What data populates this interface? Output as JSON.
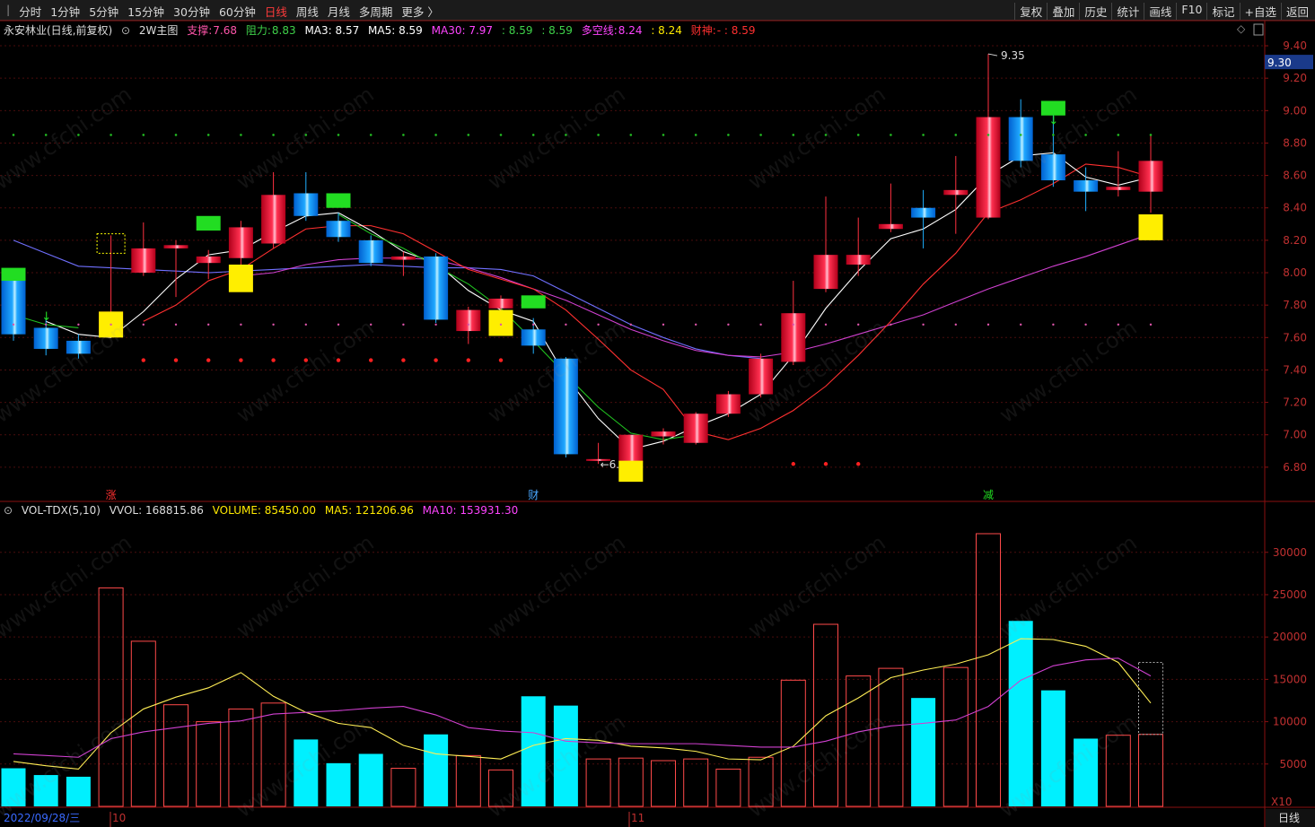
{
  "toolbar": {
    "left": [
      "分时",
      "1分钟",
      "5分钟",
      "15分钟",
      "30分钟",
      "60分钟",
      "日线",
      "周线",
      "月线",
      "多周期",
      "更多 〉"
    ],
    "active_index": 6,
    "right": [
      "复权",
      "叠加",
      "历史",
      "统计",
      "画线",
      "F10",
      "标记",
      "+自选",
      "返回"
    ]
  },
  "legend": {
    "stock": "永安林业(日线,前复权)",
    "indicator": "2W主图",
    "support_label": "支撑:",
    "support_value": "7.68",
    "resist_label": "阻力:",
    "resist_value": "8.83",
    "ma3": "MA3: 8.57",
    "ma5": "MA5: 8.59",
    "ma30": "MA30: 7.97",
    "v1": ": 8.59",
    "v2": ": 8.59",
    "dk_label": "多空线:",
    "dk_value": "8.24",
    "v3": ": 8.24",
    "cs_label": "财神:",
    "cs_value": "- : 8.59"
  },
  "vol_legend": {
    "name": "VOL-TDX(5,10)",
    "vvol": "VVOL: 168815.86",
    "volume": "VOLUME: 85450.00",
    "ma5": "MA5: 121206.96",
    "ma10": "MA10: 153931.30"
  },
  "price_badge": "9.30",
  "high_label": "9.35",
  "low_label": "6.",
  "markers": [
    "涨",
    "财",
    "减"
  ],
  "date_label": "2022/09/28/三",
  "month_labels": [
    "10",
    "11"
  ],
  "x10_label": "X10",
  "period_label": "日线",
  "watermark": "www.cfchi.com",
  "colors": {
    "up": "#ff2b3c",
    "down": "#1aa6ff",
    "ma_white": "#ffffff",
    "ma_red": "#ff3030",
    "ma_mag": "#d040d0",
    "ma_blue": "#6a6aff",
    "ma_green": "#20c020"
  },
  "chart_data": {
    "type": "candlestick",
    "price_axis": {
      "ticks": [
        6.8,
        7.0,
        7.2,
        7.4,
        7.6,
        7.8,
        8.0,
        8.2,
        8.4,
        8.6,
        8.8,
        9.0,
        9.2,
        9.4
      ],
      "ylim": [
        6.6,
        9.45
      ]
    },
    "volume_axis": {
      "ticks": [
        5000,
        10000,
        15000,
        20000,
        25000,
        30000
      ],
      "ylim": [
        0,
        34000
      ]
    },
    "candles": [
      {
        "o": 7.96,
        "c": 7.62,
        "h": 7.98,
        "l": 7.58
      },
      {
        "o": 7.66,
        "c": 7.53,
        "h": 7.72,
        "l": 7.49
      },
      {
        "o": 7.58,
        "c": 7.5,
        "h": 7.62,
        "l": 7.47
      },
      {
        "o": 7.62,
        "c": 7.76,
        "h": 8.23,
        "l": 7.6
      },
      {
        "o": 8.0,
        "c": 8.15,
        "h": 8.31,
        "l": 7.98
      },
      {
        "o": 8.15,
        "c": 8.17,
        "h": 8.2,
        "l": 7.85
      },
      {
        "o": 8.06,
        "c": 8.1,
        "h": 8.14,
        "l": 7.96
      },
      {
        "o": 8.09,
        "c": 8.28,
        "h": 8.32,
        "l": 8.05
      },
      {
        "o": 8.18,
        "c": 8.48,
        "h": 8.62,
        "l": 8.15
      },
      {
        "o": 8.49,
        "c": 8.35,
        "h": 8.62,
        "l": 8.32
      },
      {
        "o": 8.32,
        "c": 8.22,
        "h": 8.37,
        "l": 8.19
      },
      {
        "o": 8.2,
        "c": 8.06,
        "h": 8.23,
        "l": 8.04
      },
      {
        "o": 8.08,
        "c": 8.1,
        "h": 8.13,
        "l": 7.98
      },
      {
        "o": 8.1,
        "c": 7.71,
        "h": 8.12,
        "l": 7.69
      },
      {
        "o": 7.64,
        "c": 7.77,
        "h": 7.79,
        "l": 7.56
      },
      {
        "o": 7.78,
        "c": 7.84,
        "h": 7.86,
        "l": 7.76
      },
      {
        "o": 7.65,
        "c": 7.55,
        "h": 7.72,
        "l": 7.5
      },
      {
        "o": 7.47,
        "c": 6.88,
        "h": 7.48,
        "l": 6.86
      },
      {
        "o": 6.84,
        "c": 6.85,
        "h": 6.95,
        "l": 6.82
      },
      {
        "o": 6.83,
        "c": 7.0,
        "h": 7.0,
        "l": 6.81
      },
      {
        "o": 6.99,
        "c": 7.02,
        "h": 7.04,
        "l": 6.94
      },
      {
        "o": 6.95,
        "c": 7.13,
        "h": 7.14,
        "l": 6.94
      },
      {
        "o": 7.13,
        "c": 7.25,
        "h": 7.27,
        "l": 7.11
      },
      {
        "o": 7.25,
        "c": 7.47,
        "h": 7.5,
        "l": 7.23
      },
      {
        "o": 7.45,
        "c": 7.75,
        "h": 7.95,
        "l": 7.43
      },
      {
        "o": 7.9,
        "c": 8.11,
        "h": 8.47,
        "l": 7.88
      },
      {
        "o": 8.05,
        "c": 8.11,
        "h": 8.34,
        "l": 7.98
      },
      {
        "o": 8.27,
        "c": 8.3,
        "h": 8.55,
        "l": 8.25
      },
      {
        "o": 8.4,
        "c": 8.34,
        "h": 8.51,
        "l": 8.15
      },
      {
        "o": 8.48,
        "c": 8.51,
        "h": 8.72,
        "l": 8.24
      },
      {
        "o": 8.34,
        "c": 8.96,
        "h": 9.35,
        "l": 8.33
      },
      {
        "o": 8.96,
        "c": 8.69,
        "h": 9.07,
        "l": 8.65
      },
      {
        "o": 8.73,
        "c": 8.57,
        "h": 9.0,
        "l": 8.53
      },
      {
        "o": 8.57,
        "c": 8.5,
        "h": 8.65,
        "l": 8.38
      },
      {
        "o": 8.51,
        "c": 8.53,
        "h": 8.75,
        "l": 8.47
      },
      {
        "o": 8.5,
        "c": 8.69,
        "h": 8.85,
        "l": 8.37
      }
    ],
    "volumes": [
      4500,
      3700,
      3500,
      25800,
      19500,
      12000,
      10000,
      11500,
      12200,
      7900,
      5100,
      6200,
      4500,
      8500,
      6000,
      4300,
      13000,
      11900,
      5600,
      5700,
      5400,
      5600,
      4400,
      5800,
      14900,
      21500,
      15400,
      16300,
      12800,
      16400,
      32200,
      21900,
      13700,
      8000,
      8400,
      8500
    ],
    "ma_white": [
      null,
      7.7,
      7.62,
      7.6,
      7.76,
      7.96,
      8.11,
      8.14,
      8.25,
      8.35,
      8.37,
      8.26,
      8.13,
      8.06,
      7.89,
      7.77,
      7.7,
      7.36,
      7.1,
      6.91,
      6.96,
      7.05,
      7.13,
      7.25,
      7.49,
      7.78,
      8.01,
      8.21,
      8.27,
      8.39,
      8.6,
      8.72,
      8.74,
      8.59,
      8.54,
      8.59
    ],
    "ma_red": [
      null,
      null,
      null,
      null,
      7.7,
      7.8,
      7.95,
      8.02,
      8.15,
      8.27,
      8.29,
      8.29,
      8.24,
      8.13,
      8.02,
      7.96,
      7.9,
      7.77,
      7.59,
      7.4,
      7.28,
      7.02,
      6.97,
      7.04,
      7.15,
      7.3,
      7.49,
      7.7,
      7.93,
      8.12,
      8.37,
      8.45,
      8.55,
      8.67,
      8.65,
      8.59
    ],
    "ma_magenta": [
      null,
      null,
      null,
      null,
      null,
      null,
      null,
      7.98,
      8.0,
      8.05,
      8.08,
      8.09,
      8.09,
      8.08,
      8.03,
      7.97,
      7.9,
      7.83,
      7.74,
      7.65,
      7.58,
      7.52,
      7.49,
      7.48,
      7.51,
      7.56,
      7.62,
      7.68,
      7.74,
      7.82,
      7.9,
      7.97,
      8.04,
      8.1,
      8.17,
      8.24
    ],
    "ma_blue": [
      8.2,
      8.12,
      8.04,
      8.03,
      8.02,
      8.01,
      8.0,
      8.01,
      8.02,
      8.03,
      8.04,
      8.05,
      8.04,
      8.03,
      8.03,
      8.02,
      7.98,
      7.88,
      7.78,
      7.68,
      7.6,
      7.53,
      7.49,
      7.47
    ],
    "ma_green": [
      7.74,
      7.68,
      7.66,
      null,
      null,
      null,
      null,
      null,
      null,
      null,
      8.36,
      8.24,
      8.15,
      8.04,
      7.93,
      7.78,
      7.58,
      7.37,
      7.17,
      7.01,
      6.97,
      7.0
    ],
    "vol_ma5": [
      5300,
      4800,
      4400,
      8700,
      11500,
      12900,
      14000,
      15800,
      13000,
      11100,
      9800,
      9300,
      7200,
      6200,
      5900,
      5600,
      7200,
      8000,
      7800,
      7100,
      6900,
      6500,
      5600,
      5500,
      7100,
      10700,
      12800,
      15200,
      16100,
      16800,
      17900,
      19800,
      19700,
      18900,
      17000,
      12200
    ],
    "vol_ma10": [
      6200,
      6000,
      5800,
      8000,
      8800,
      9300,
      9800,
      10100,
      10900,
      11100,
      11300,
      11600,
      11800,
      10800,
      9300,
      8900,
      8700,
      7700,
      7500,
      7400,
      7400,
      7400,
      7200,
      7000,
      7000,
      7700,
      8800,
      9500,
      9800,
      10200,
      11800,
      14900,
      16600,
      17300,
      17500,
      15400
    ]
  }
}
